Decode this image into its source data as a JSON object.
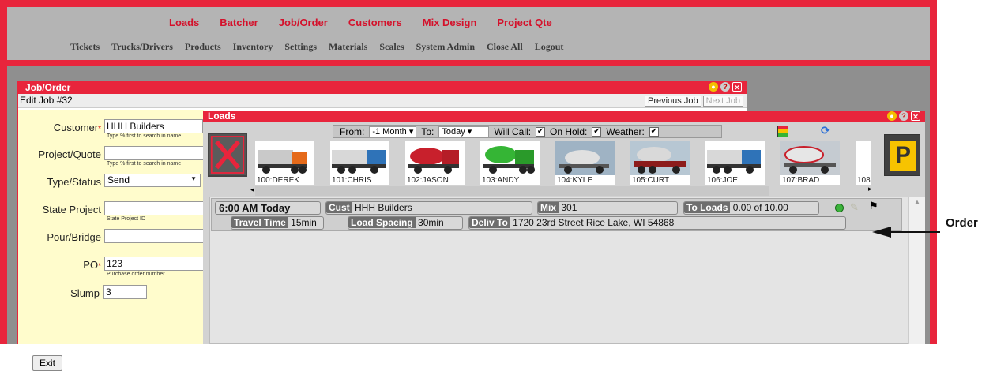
{
  "nav_primary": [
    "Loads",
    "Batcher",
    "Job/Order",
    "Customers",
    "Mix Design",
    "Project Qte"
  ],
  "nav_secondary": [
    "Tickets",
    "Trucks/Drivers",
    "Products",
    "Inventory",
    "Settings",
    "Materials",
    "Scales",
    "System Admin",
    "Close All",
    "Logout"
  ],
  "job_window": {
    "title": "Job/Order",
    "subtitle": "Edit Job #32",
    "prev_btn": "Previous Job",
    "next_btn": "Next Job",
    "customer_label": "Customer",
    "customer_value": "HHH Builders",
    "customer_hint": "Type % first to search in name",
    "project_label": "Project/Quote",
    "project_hint": "Type % first to search in name",
    "type_label": "Type/Status",
    "type_value": "Send",
    "state_label": "State Project",
    "state_hint": "State Project ID",
    "pour_label": "Pour/Bridge",
    "po_label": "PO",
    "po_value": "123",
    "po_hint": "Purchase order number",
    "slump_label": "Slump",
    "slump_value": "3",
    "exit_btn": "Exit"
  },
  "loads_window": {
    "title": "Loads",
    "from_label": "From:",
    "from_value": "-1 Month",
    "to_label": "To:",
    "to_value": "Today",
    "willcall_label": "Will Call:",
    "onhold_label": "On Hold:",
    "weather_label": "Weather:",
    "trucks": [
      "100:DEREK",
      "101:CHRIS",
      "102:JASON",
      "103:ANDY",
      "104:KYLE",
      "105:CURT",
      "106:JOE",
      "107:BRAD",
      "108"
    ],
    "park_label": "P"
  },
  "order": {
    "time": "6:00 AM Today",
    "cust_label": "Cust",
    "cust_value": "HHH Builders",
    "mix_label": "Mix",
    "mix_value": "301",
    "toloads_label": "To Loads",
    "toloads_value": "0.00 of 10.00",
    "travel_label": "Travel Time",
    "travel_value": "15min",
    "spacing_label": "Load Spacing",
    "spacing_value": "30min",
    "deliv_label": "Deliv To",
    "deliv_value": "1720 23rd Street Rice Lake, WI 54868"
  },
  "annotation": "Order",
  "colors": {
    "frame": "#e8253c",
    "nav_primary": "#d4112b",
    "form_bg": "#fffccc"
  }
}
